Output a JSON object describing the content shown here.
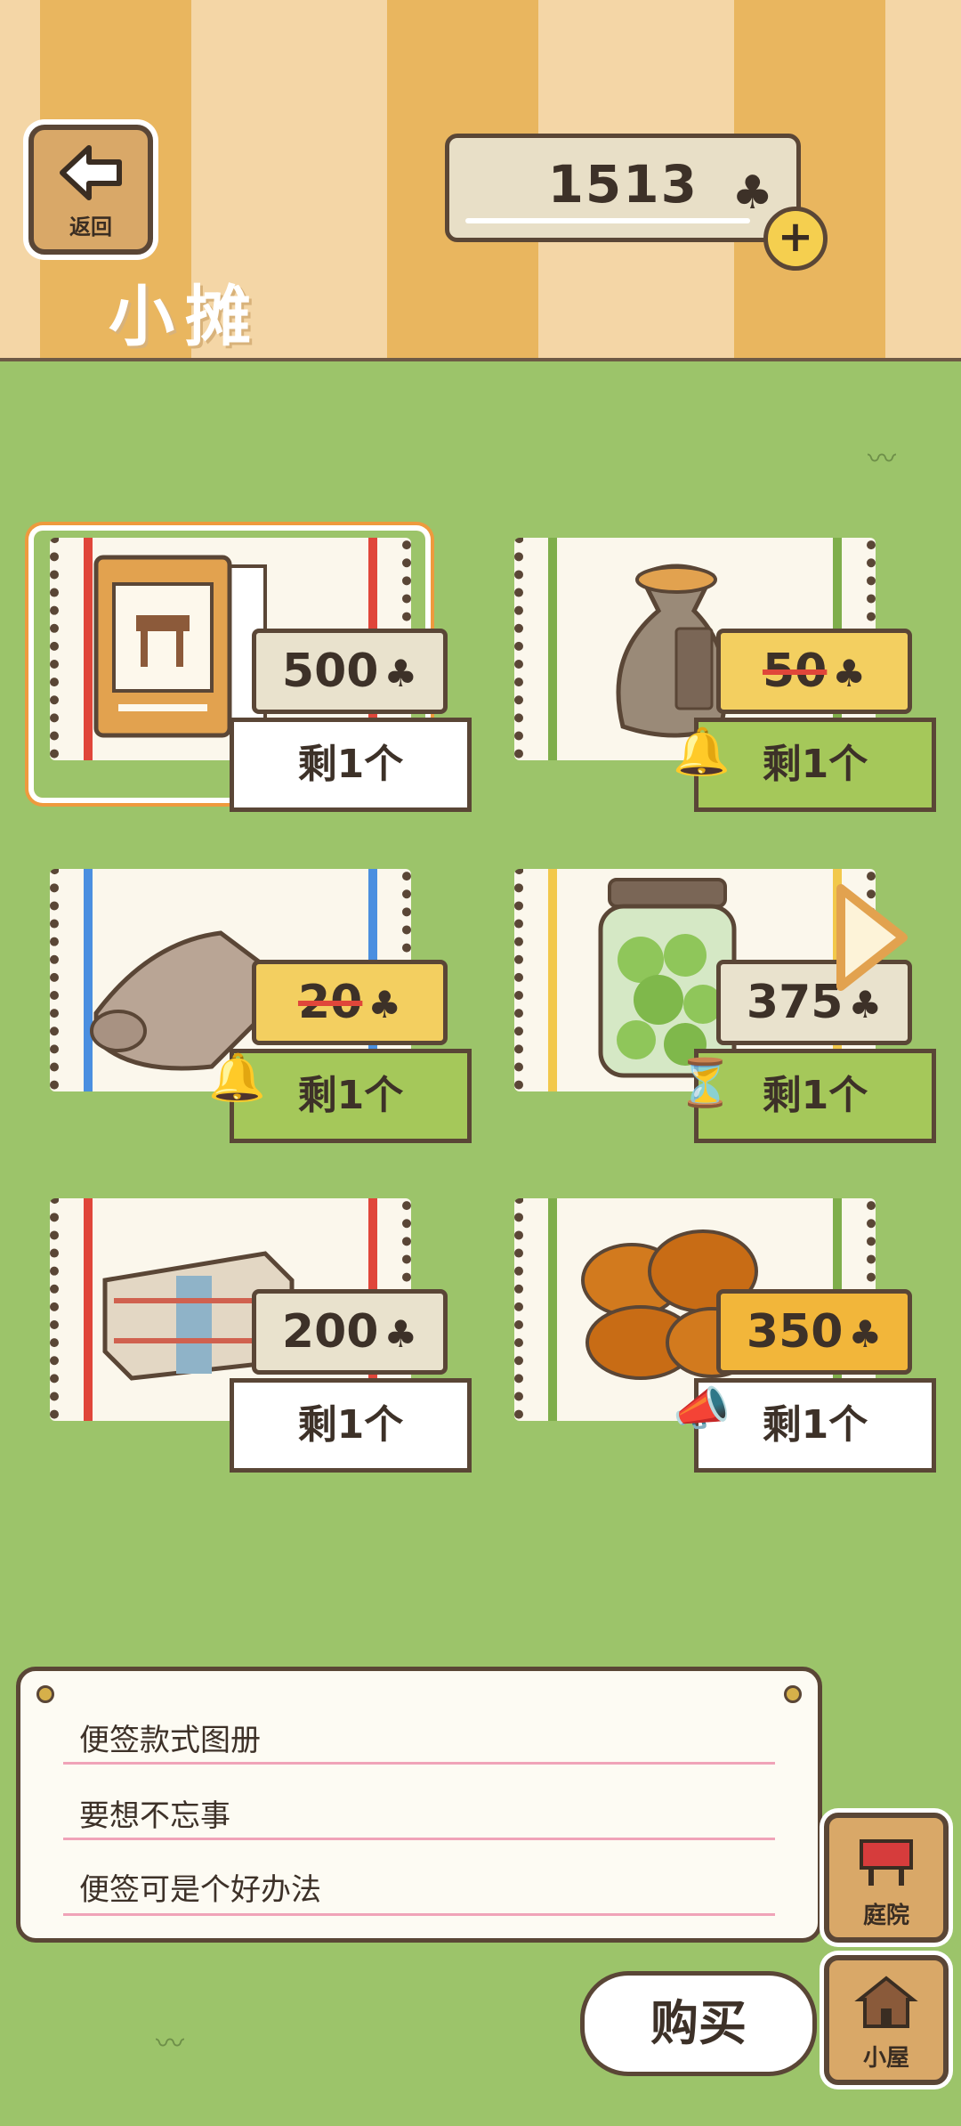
{
  "header": {
    "back_label": "返回",
    "currency_value": "1513",
    "currency_icon": "clover",
    "title": "小摊"
  },
  "items": [
    {
      "name": "note-album",
      "price": "500",
      "stock": "剩1个",
      "style": "normal",
      "selected": true,
      "stripe_color": "#e0463a"
    },
    {
      "name": "tulip-seed-bag",
      "price": "50",
      "stock": "剩1个",
      "style": "sale",
      "stripe_color": "#7fae4b"
    },
    {
      "name": "blanket",
      "price": "20",
      "stock": "剩1个",
      "style": "sale",
      "stripe_color": "#4a8fe0"
    },
    {
      "name": "green-bean-jar",
      "price": "375",
      "stock": "剩1个",
      "style": "timed",
      "stripe_color": "#f2c84b"
    },
    {
      "name": "striped-cloth",
      "price": "200",
      "stock": "剩1个",
      "style": "normal",
      "stripe_color": "#e0463a"
    },
    {
      "name": "fried-dough",
      "price": "350",
      "stock": "剩1个",
      "style": "gold",
      "stripe_color": "#7fae4b"
    }
  ],
  "note": {
    "line1": "便签款式图册",
    "line2": "要想不忘事",
    "line3": "便签可是个好办法"
  },
  "side_buttons": {
    "yard": "庭院",
    "house": "小屋"
  },
  "buy_label": "购买",
  "colors": {
    "header_orange": "#e9b65f",
    "grass": "#9cc46a",
    "outline": "#5a4636"
  }
}
